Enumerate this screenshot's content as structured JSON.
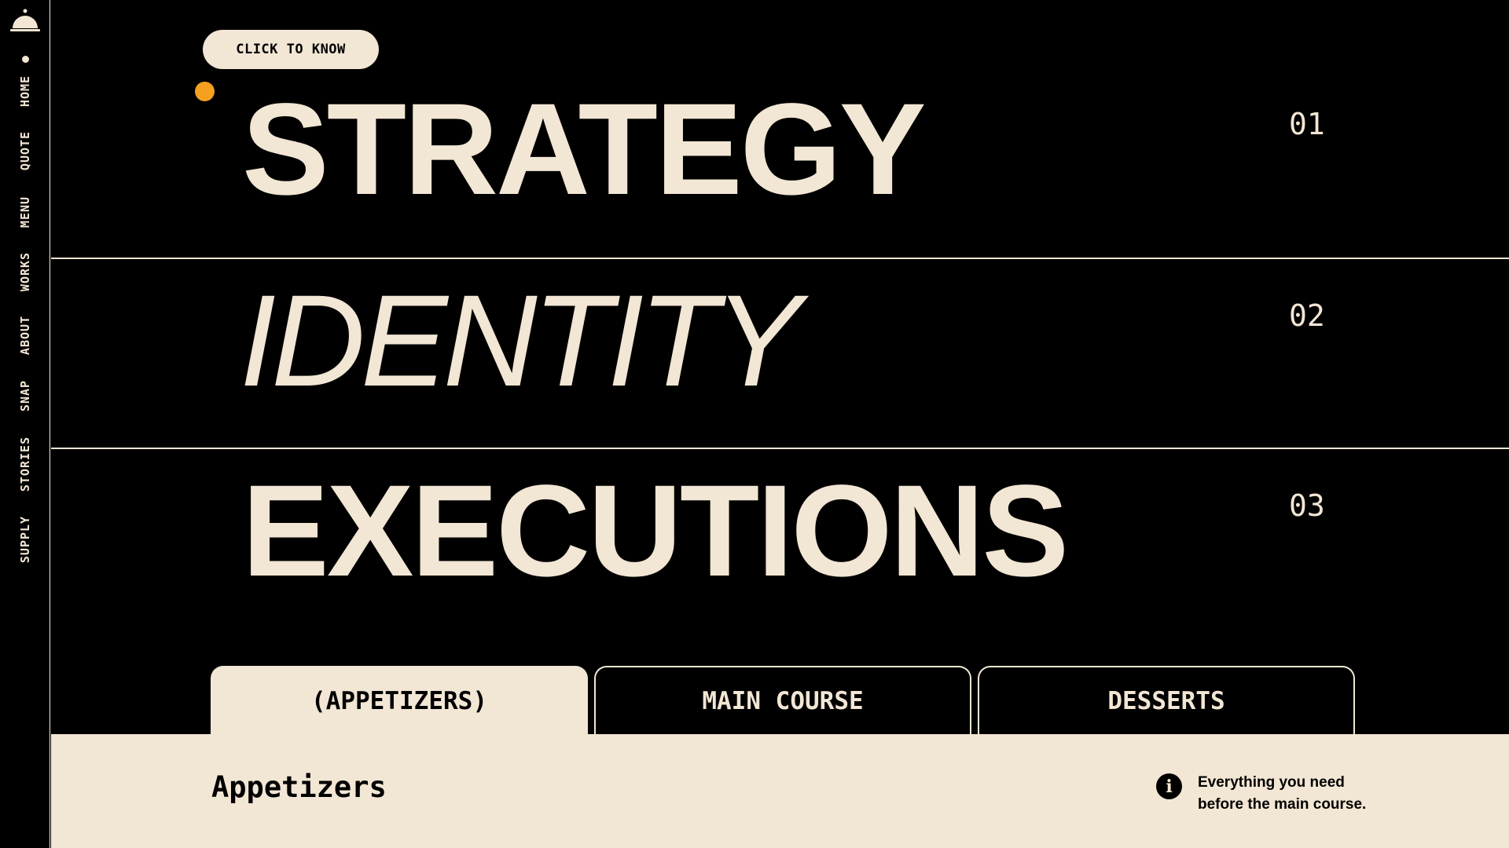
{
  "sidebar": {
    "logo_icon": "cloche-icon",
    "items": [
      {
        "label": "HOME"
      },
      {
        "label": "QUOTE"
      },
      {
        "label": "MENU"
      },
      {
        "label": "WORKS"
      },
      {
        "label": "ABOUT"
      },
      {
        "label": "SNAP"
      },
      {
        "label": "STORIES"
      },
      {
        "label": "SUPPLY"
      }
    ]
  },
  "hero": {
    "cta_label": "CLICK TO KNOW",
    "rows": [
      {
        "word": "STRATEGY",
        "number": "01"
      },
      {
        "word": "IDENTITY",
        "number": "02"
      },
      {
        "word": "EXECUTIONS",
        "number": "03"
      }
    ]
  },
  "tabs": [
    {
      "label": "(APPETIZERS)",
      "active": true
    },
    {
      "label": "MAIN COURSE",
      "active": false
    },
    {
      "label": "DESSERTS",
      "active": false
    }
  ],
  "panel": {
    "title": "Appetizers",
    "info_icon": "info-icon",
    "info_text": "Everything you need before the main course."
  },
  "colors": {
    "background": "#000000",
    "cream": "#f2e6d4",
    "accent": "#f5a01f"
  }
}
